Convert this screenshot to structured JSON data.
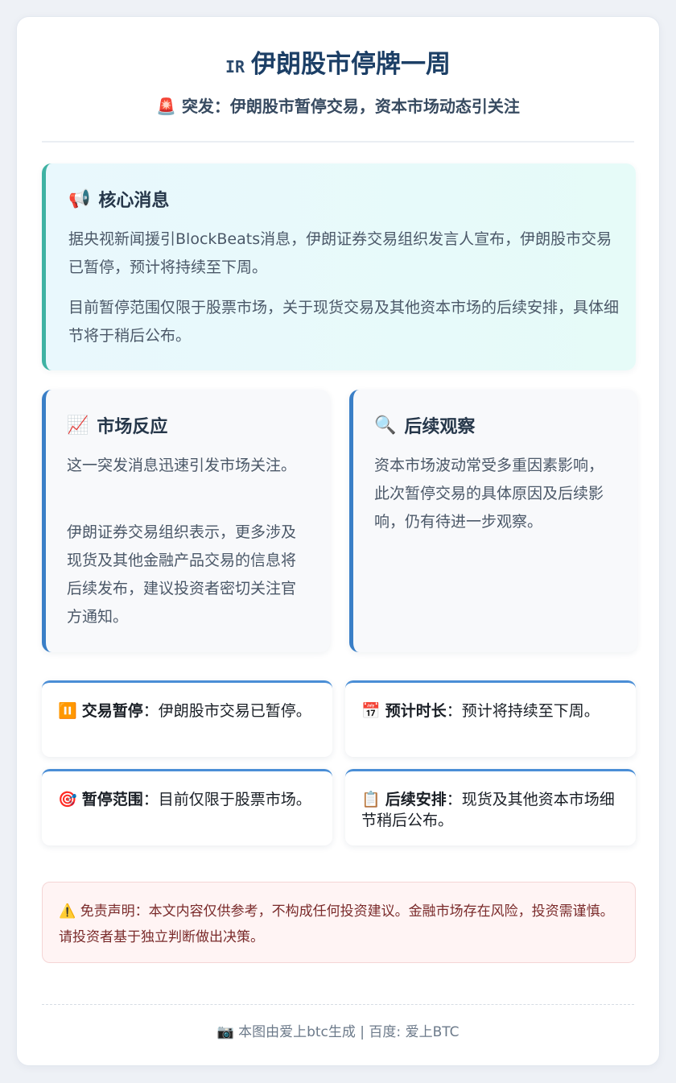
{
  "header": {
    "flag": "IR",
    "title": "伊朗股市停牌一周",
    "subtitle_icon": "🚨",
    "subtitle": "突发：伊朗股市暂停交易，资本市场动态引关注"
  },
  "core": {
    "icon": "📢",
    "title": "核心消息",
    "p1": "据央视新闻援引BlockBeats消息，伊朗证券交易组织发言人宣布，伊朗股市交易已暂停，预计将持续至下周。",
    "p2": "目前暂停范围仅限于股票市场，关于现货交易及其他资本市场的后续安排，具体细节将于稍后公布。"
  },
  "market": {
    "icon": "📈",
    "title": "市场反应",
    "p1": "这一突发消息迅速引发市场关注。",
    "p2": "伊朗证券交易组织表示，更多涉及现货及其他金融产品交易的信息将后续发布，建议投资者密切关注官方通知。"
  },
  "observe": {
    "icon": "🔍",
    "title": "后续观察",
    "p1": "资本市场波动常受多重因素影响，此次暂停交易的具体原因及后续影响，仍有待进一步观察。"
  },
  "tiles": [
    {
      "icon": "⏸️",
      "label": "交易暂停",
      "text": "：伊朗股市交易已暂停。"
    },
    {
      "icon": "📅",
      "label": "预计时长",
      "text": "：预计将持续至下周。"
    },
    {
      "icon": "🎯",
      "label": "暂停范围",
      "text": "：目前仅限于股票市场。"
    },
    {
      "icon": "📋",
      "label": "后续安排",
      "text": "：现货及其他资本市场细节稍后公布。"
    }
  ],
  "disclaimer": {
    "icon": "⚠️",
    "text": "免责声明：本文内容仅供参考，不构成任何投资建议。金融市场存在风险，投资需谨慎。请投资者基于独立判断做出决策。"
  },
  "footer": {
    "icon": "📷",
    "text": "本图由爱上btc生成 | 百度: 爱上BTC"
  }
}
